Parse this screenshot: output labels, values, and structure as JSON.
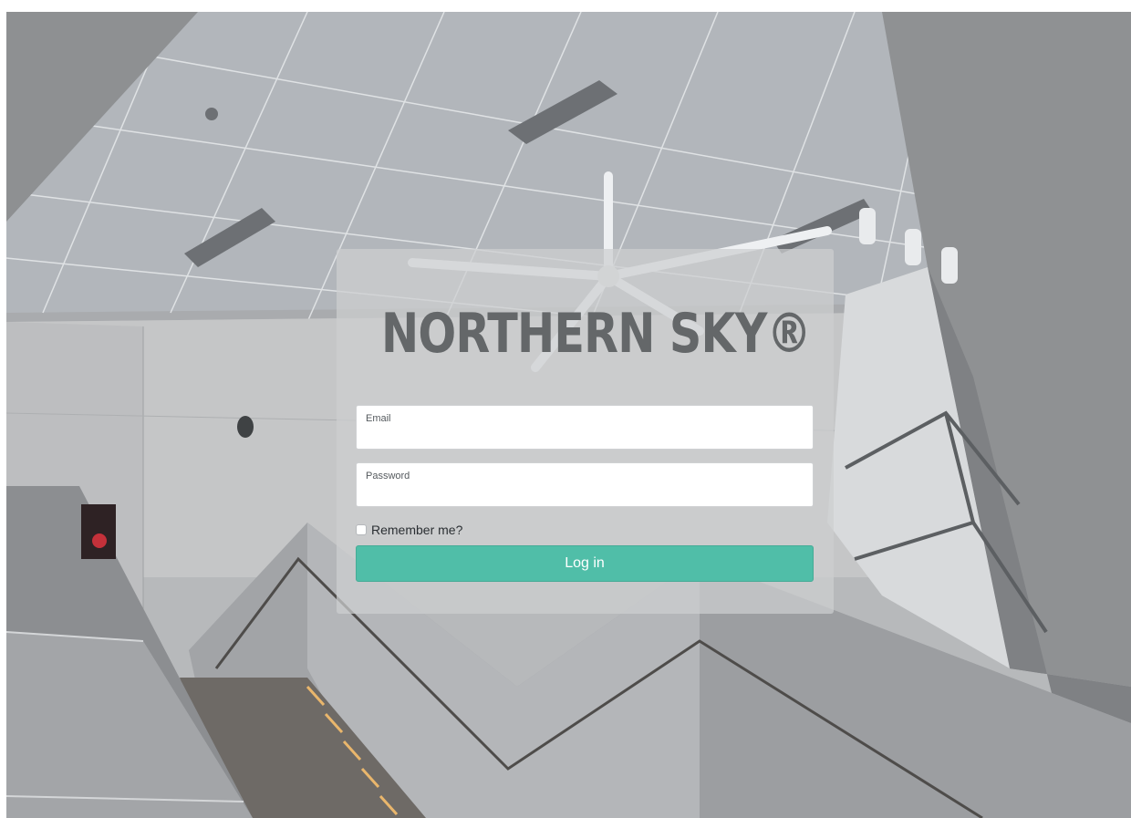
{
  "brand": {
    "name": "NORTHERN SKY®"
  },
  "form": {
    "email_label": "Email",
    "email_value": "",
    "password_label": "Password",
    "password_value": "",
    "remember_label": "Remember me?",
    "remember_checked": false,
    "login_label": "Log in"
  },
  "colors": {
    "accent": "#50bea8",
    "brand_text": "#646769"
  }
}
